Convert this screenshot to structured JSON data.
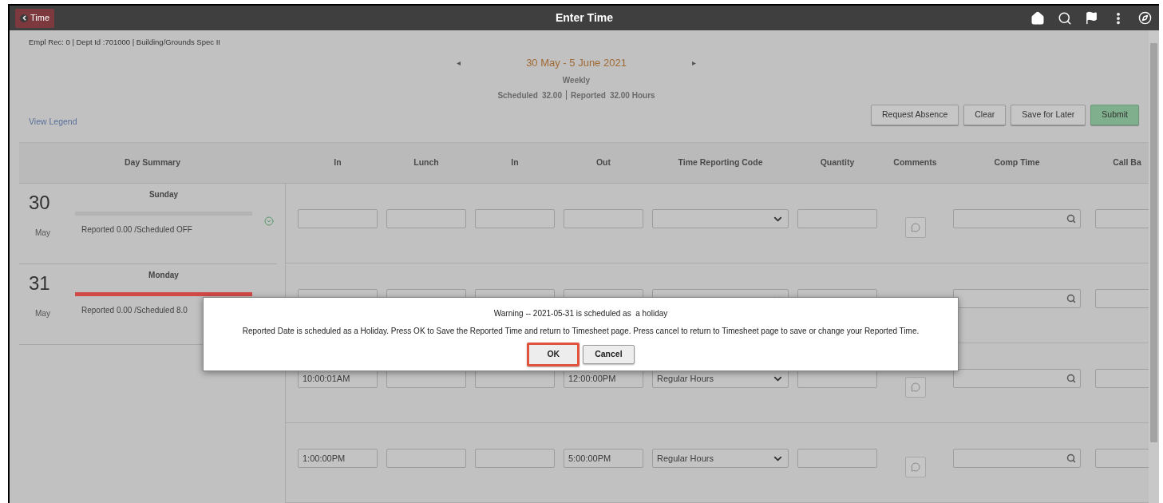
{
  "header": {
    "back_button": "Time",
    "title": "Enter Time"
  },
  "employee_info": "Empl Rec: 0 | Dept Id :701000 | Building/Grounds Spec II",
  "period": {
    "prev": "◂",
    "range": "30 May - 5 June 2021",
    "next": "▸",
    "frequency": "Weekly",
    "scheduled_label": "Scheduled",
    "scheduled_value": "32.00",
    "reported_label": "Reported",
    "reported_value": "32.00 Hours"
  },
  "view_legend": "View Legend",
  "actions": [
    {
      "label": "Request Absence",
      "kind": "default"
    },
    {
      "label": "Clear",
      "kind": "default"
    },
    {
      "label": "Save for Later",
      "kind": "default"
    },
    {
      "label": "Submit",
      "kind": "primary"
    }
  ],
  "table": {
    "day_column": "Day Summary",
    "columns": [
      {
        "label": "In",
        "kind": "text"
      },
      {
        "label": "Lunch",
        "kind": "text"
      },
      {
        "label": "In",
        "kind": "text"
      },
      {
        "label": "Out",
        "kind": "text"
      },
      {
        "label": "Time Reporting Code",
        "kind": "select"
      },
      {
        "label": "Quantity",
        "kind": "text"
      },
      {
        "label": "Comments",
        "kind": "comment"
      },
      {
        "label": "Comp Time",
        "kind": "search"
      },
      {
        "label": "Call Ba",
        "kind": "text"
      }
    ],
    "days": [
      {
        "day": "30",
        "month": "May",
        "weekday": "Sunday",
        "summary": "Reported 0.00 /Scheduled OFF",
        "color": "#b3b3b3"
      },
      {
        "day": "31",
        "month": "May",
        "weekday": "Monday",
        "summary": "Reported 0.00 /Scheduled 8.0",
        "color": "#d24a48"
      }
    ],
    "rows": [
      {
        "cells": [
          null,
          null,
          null,
          null,
          null,
          null,
          null,
          null,
          null
        ]
      },
      {
        "cells": [
          null,
          null,
          null,
          null,
          null,
          null,
          null,
          null,
          null
        ]
      },
      {
        "cells": [
          "10:00:01AM",
          null,
          null,
          "12:00:00PM",
          "Regular Hours",
          null,
          null,
          null,
          null
        ]
      },
      {
        "cells": [
          "1:00:00PM",
          null,
          null,
          "5:00:00PM",
          "Regular Hours",
          null,
          null,
          null,
          null
        ]
      }
    ]
  },
  "dialog": {
    "title": "Warning -- 2021-05-31 is scheduled as  a holiday",
    "message": "Reported Date is scheduled as a Holiday. Press OK to Save the Reported Time and return to Timesheet page. Press cancel to return to Timesheet page to save or change your Reported Time.",
    "buttons": [
      {
        "label": "OK",
        "focused": true
      },
      {
        "label": "Cancel",
        "focused": false
      }
    ]
  }
}
